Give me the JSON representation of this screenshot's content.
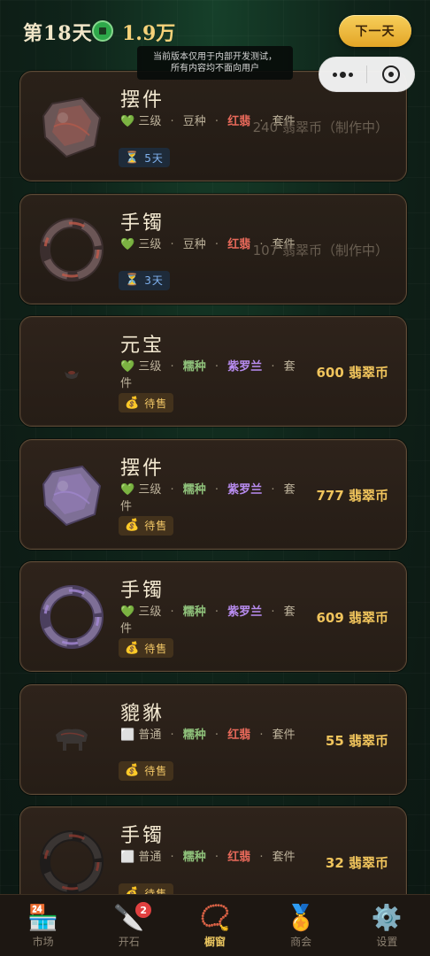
{
  "header": {
    "day": "第18天",
    "money": "1.9万",
    "next_button": "下一天",
    "coin_icon": "jade-coin-icon",
    "notice": [
      "当前版本仅用于内部开发测试，",
      "所有内容均不面向用户"
    ]
  },
  "capsule": {
    "menu_icon": "more-dots-icon",
    "close_icon": "target-icon"
  },
  "items": [
    {
      "name": "摆件",
      "grade_icon": "💚",
      "grade": "三级",
      "texture": "豆种",
      "color": "红翡",
      "suite": "套件",
      "texture_color": "gray",
      "color_color": "red",
      "status": "time",
      "status_text": "5天",
      "status_icon": "hourglass-icon",
      "price": "240 翡翠币（制作中）",
      "making": true,
      "shape": "stone",
      "tone": "red"
    },
    {
      "name": "手镯",
      "grade_icon": "💚",
      "grade": "三级",
      "texture": "豆种",
      "color": "红翡",
      "suite": "套件",
      "texture_color": "gray",
      "color_color": "red",
      "status": "time",
      "status_text": "3天",
      "status_icon": "hourglass-icon",
      "price": "107 翡翠币（制作中）",
      "making": true,
      "shape": "bangle",
      "tone": "red"
    },
    {
      "name": "元宝",
      "grade_icon": "💚",
      "grade": "三级",
      "texture": "糯种",
      "color": "紫罗兰",
      "suite": "套件",
      "texture_color": "green",
      "color_color": "purple",
      "status": "sale",
      "status_text": "待售",
      "status_icon": "money-bag-icon",
      "price": "600 翡翠币",
      "making": false,
      "shape": "ingot",
      "tone": "dark"
    },
    {
      "name": "摆件",
      "grade_icon": "💚",
      "grade": "三级",
      "texture": "糯种",
      "color": "紫罗兰",
      "suite": "套件",
      "texture_color": "green",
      "color_color": "purple",
      "status": "sale",
      "status_text": "待售",
      "status_icon": "money-bag-icon",
      "price": "777 翡翠币",
      "making": false,
      "shape": "stone",
      "tone": "purple"
    },
    {
      "name": "手镯",
      "grade_icon": "💚",
      "grade": "三级",
      "texture": "糯种",
      "color": "紫罗兰",
      "suite": "套件",
      "texture_color": "green",
      "color_color": "purple",
      "status": "sale",
      "status_text": "待售",
      "status_icon": "money-bag-icon",
      "price": "609 翡翠币",
      "making": false,
      "shape": "bangle",
      "tone": "purple"
    },
    {
      "name": "貔貅",
      "grade_icon": "⬜",
      "grade": "普通",
      "texture": "糯种",
      "color": "红翡",
      "suite": "套件",
      "texture_color": "green",
      "color_color": "red",
      "status": "sale",
      "status_text": "待售",
      "status_icon": "money-bag-icon",
      "price": "55 翡翠币",
      "making": false,
      "shape": "beast",
      "tone": "dark"
    },
    {
      "name": "手镯",
      "grade_icon": "⬜",
      "grade": "普通",
      "texture": "糯种",
      "color": "红翡",
      "suite": "套件",
      "texture_color": "green",
      "color_color": "red",
      "status": "sale",
      "status_text": "待售",
      "status_icon": "money-bag-icon",
      "price": "32 翡翠币",
      "making": false,
      "shape": "bangle",
      "tone": "dark"
    }
  ],
  "nav": [
    {
      "label": "市场",
      "icon": "🏪",
      "icon_name": "store-icon",
      "active": false,
      "badge": ""
    },
    {
      "label": "开石",
      "icon": "🔪",
      "icon_name": "knife-icon",
      "active": false,
      "badge": "2"
    },
    {
      "label": "橱窗",
      "icon": "📿",
      "icon_name": "beads-icon",
      "active": true,
      "badge": ""
    },
    {
      "label": "商会",
      "icon": "🏅",
      "icon_name": "medal-icon",
      "active": false,
      "badge": ""
    },
    {
      "label": "设置",
      "icon": "⚙️",
      "icon_name": "gear-icon",
      "active": false,
      "badge": ""
    }
  ]
}
